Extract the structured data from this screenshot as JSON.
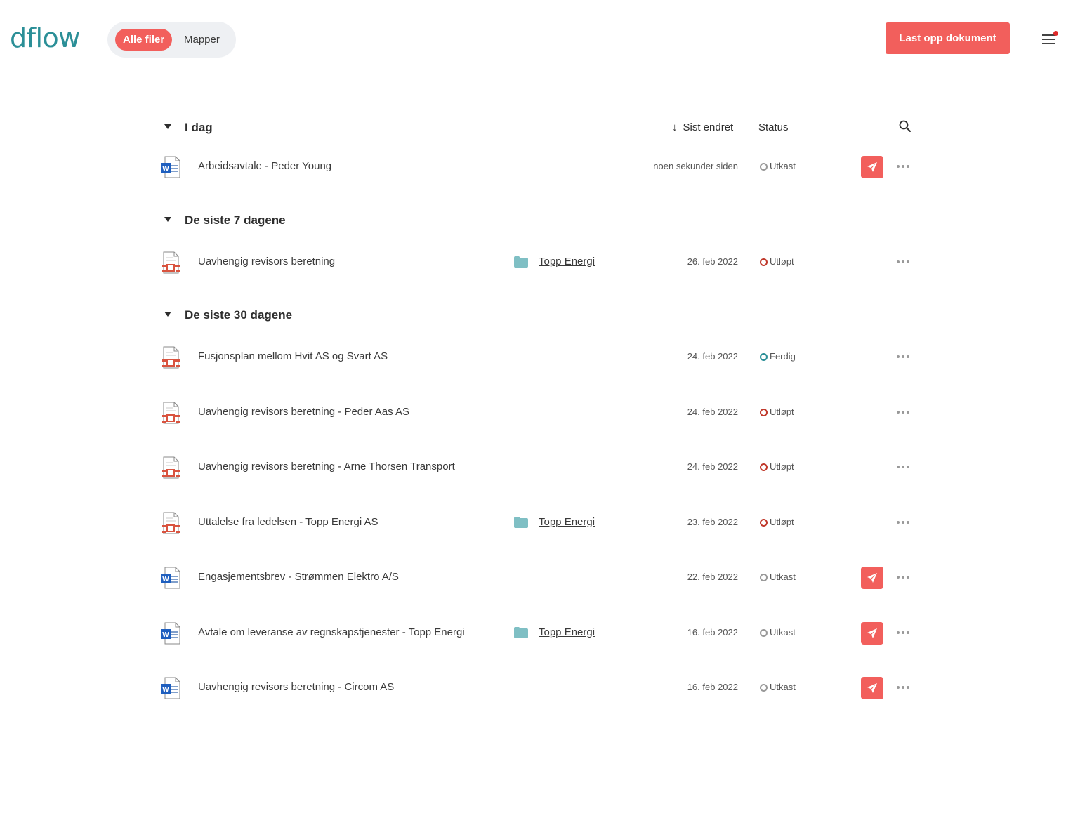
{
  "app": {
    "logo": "dflow"
  },
  "view_toggle": {
    "all_files": "Alle filer",
    "folders": "Mapper"
  },
  "header": {
    "upload_label": "Last opp dokument"
  },
  "columns": {
    "sort_arrow": "↓",
    "last_changed": "Sist endret",
    "status": "Status"
  },
  "colors": {
    "accent": "#f25f5c",
    "brand": "#2b8f97",
    "folder": "#7fbfc4",
    "status_expired": "#c0392b",
    "status_done": "#2b8f97",
    "status_draft": "#999999"
  },
  "groups": [
    {
      "title": "I dag",
      "rows": [
        {
          "name": "Arbeidsavtale - Peder Young",
          "icon": "word",
          "folder": "",
          "date": "noen sekunder siden",
          "status": "Utkast",
          "status_kind": "draft",
          "send": true
        }
      ]
    },
    {
      "title": "De siste 7 dagene",
      "rows": [
        {
          "name": "Uavhengig revisors beretning",
          "icon": "pdf",
          "folder": "Topp Energi",
          "date": "26. feb 2022",
          "status": "Utløpt",
          "status_kind": "expired",
          "send": false
        }
      ]
    },
    {
      "title": "De siste 30 dagene",
      "rows": [
        {
          "name": "Fusjonsplan mellom Hvit AS og Svart AS",
          "icon": "pdf",
          "folder": "",
          "date": "24. feb 2022",
          "status": "Ferdig",
          "status_kind": "done",
          "send": false
        },
        {
          "name": "Uavhengig revisors beretning - Peder Aas AS",
          "icon": "pdf",
          "folder": "",
          "date": "24. feb 2022",
          "status": "Utløpt",
          "status_kind": "expired",
          "send": false
        },
        {
          "name": "Uavhengig revisors beretning - Arne Thorsen Transport",
          "icon": "pdf",
          "folder": "",
          "date": "24. feb 2022",
          "status": "Utløpt",
          "status_kind": "expired",
          "send": false
        },
        {
          "name": "Uttalelse fra ledelsen - Topp Energi AS",
          "icon": "pdf",
          "folder": "Topp Energi",
          "date": "23. feb 2022",
          "status": "Utløpt",
          "status_kind": "expired",
          "send": false
        },
        {
          "name": "Engasjementsbrev - Strømmen Elektro A/S",
          "icon": "word",
          "folder": "",
          "date": "22. feb 2022",
          "status": "Utkast",
          "status_kind": "draft",
          "send": true
        },
        {
          "name": "Avtale om leveranse av regnskapstjenester - Topp Energi",
          "icon": "word",
          "folder": "Topp Energi",
          "date": "16. feb 2022",
          "status": "Utkast",
          "status_kind": "draft",
          "send": true
        },
        {
          "name": "Uavhengig revisors beretning - Circom AS",
          "icon": "word",
          "folder": "",
          "date": "16. feb 2022",
          "status": "Utkast",
          "status_kind": "draft",
          "send": true
        }
      ]
    }
  ]
}
